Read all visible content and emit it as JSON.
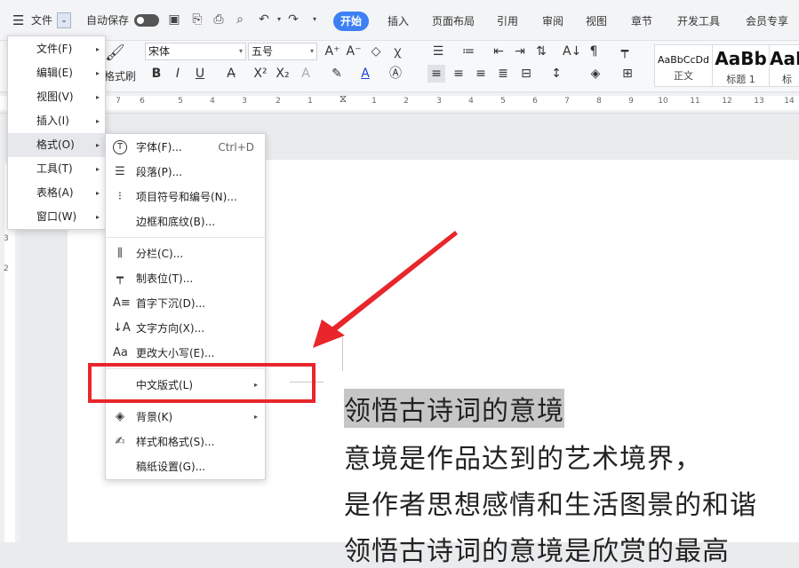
{
  "topbar": {
    "file_label": "文件",
    "autosave_label": "自动保存",
    "tabs": [
      {
        "label": "开始",
        "active": true
      },
      {
        "label": "插入"
      },
      {
        "label": "页面布局"
      },
      {
        "label": "引用"
      },
      {
        "label": "审阅"
      },
      {
        "label": "视图"
      },
      {
        "label": "章节"
      },
      {
        "label": "开发工具"
      },
      {
        "label": "会员专享"
      }
    ]
  },
  "ribbon": {
    "format_painter_label": "格式刷",
    "font_name": "宋体",
    "font_size": "五号",
    "styles": [
      {
        "sample": "AaBbCcDd",
        "name": "正文"
      },
      {
        "sample": "AaBb",
        "name": "标题 1"
      },
      {
        "sample": "AaI",
        "name": "标题"
      }
    ]
  },
  "ruler": {
    "h_numbers": [
      "7",
      "6",
      "5",
      "4",
      "3",
      "2",
      "1",
      "1",
      "2",
      "3",
      "4",
      "5",
      "6",
      "7",
      "8",
      "9",
      "10",
      "11",
      "12",
      "13",
      "14"
    ],
    "v_numbers": [
      "3",
      "2"
    ]
  },
  "main_menu": {
    "items": [
      {
        "label": "文件(F)"
      },
      {
        "label": "编辑(E)"
      },
      {
        "label": "视图(V)"
      },
      {
        "label": "插入(I)"
      },
      {
        "label": "格式(O)",
        "active": true
      },
      {
        "label": "工具(T)"
      },
      {
        "label": "表格(A)"
      },
      {
        "label": "窗口(W)"
      }
    ]
  },
  "format_menu": {
    "groups": [
      [
        {
          "label": "字体(F)...",
          "shortcut": "Ctrl+D",
          "icon": "font-icon"
        },
        {
          "label": "段落(P)...",
          "icon": "paragraph-icon"
        },
        {
          "label": "项目符号和编号(N)...",
          "icon": "list-icon"
        },
        {
          "label": "边框和底纹(B)...",
          "icon": ""
        }
      ],
      [
        {
          "label": "分栏(C)...",
          "icon": "columns-icon"
        },
        {
          "label": "制表位(T)...",
          "icon": "tab-stop-icon"
        },
        {
          "label": "首字下沉(D)...",
          "icon": "drop-cap-icon"
        },
        {
          "label": "文字方向(X)...",
          "icon": "text-direction-icon"
        },
        {
          "label": "更改大小写(E)...",
          "icon": "change-case-icon"
        }
      ],
      [
        {
          "label": "中文版式(L)",
          "icon": "",
          "submenu": true
        }
      ],
      [
        {
          "label": "背景(K)",
          "icon": "paint-bucket-icon",
          "submenu": true
        },
        {
          "label": "样式和格式(S)...",
          "icon": "styles-icon"
        },
        {
          "label": "稿纸设置(G)...",
          "icon": ""
        }
      ]
    ]
  },
  "document": {
    "lines": [
      "领悟古诗词的意境",
      "意境是作品达到的艺术境界，",
      "是作者思想感情和生活图景的和谐",
      "领悟古诗词的意境是欣赏的最高"
    ]
  },
  "annotation": {
    "color": "#e8262b"
  }
}
